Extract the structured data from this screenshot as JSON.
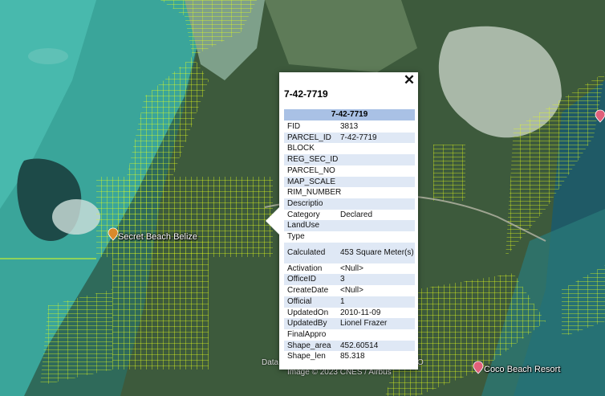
{
  "map": {
    "labels": [
      {
        "name": "Secret Beach Belize",
        "pin_color": "#d98a2b"
      },
      {
        "name": "Coco Beach Resort",
        "pin_color": "#e0607a"
      }
    ],
    "attribution_left": "Data",
    "attribution_main": "Image © 2023 CNES / Airbus",
    "attribution_right": "O"
  },
  "popup": {
    "title": "7-42-7719",
    "table_header": "7-42-7719",
    "close_symbol": "✕",
    "rows": [
      {
        "key": "FID",
        "value": "3813"
      },
      {
        "key": "PARCEL_ID",
        "value": "7-42-7719"
      },
      {
        "key": "BLOCK",
        "value": ""
      },
      {
        "key": "REG_SEC_ID",
        "value": ""
      },
      {
        "key": "PARCEL_NO",
        "value": ""
      },
      {
        "key": "MAP_SCALE",
        "value": ""
      },
      {
        "key": "RIM_NUMBER",
        "value": ""
      },
      {
        "key": "Descriptio",
        "value": ""
      },
      {
        "key": "Category",
        "value": "Declared"
      },
      {
        "key": "LandUse",
        "value": ""
      },
      {
        "key": "Type",
        "value": ""
      },
      {
        "key": "Calculated",
        "value": "453 Square Meter(s)"
      },
      {
        "key": "Activation",
        "value": "<Null>"
      },
      {
        "key": "OfficeID",
        "value": "3"
      },
      {
        "key": "CreateDate",
        "value": "<Null>"
      },
      {
        "key": "Official",
        "value": "1"
      },
      {
        "key": "UpdatedOn",
        "value": "2010-11-09"
      },
      {
        "key": "UpdatedBy",
        "value": "Lionel Frazer"
      },
      {
        "key": "FinalAppro",
        "value": ""
      },
      {
        "key": "Shape_area",
        "value": "452.60514"
      },
      {
        "key": "Shape_len",
        "value": "85.318"
      }
    ]
  },
  "colors": {
    "parcel_lines": "#e6ff1a",
    "header_bg": "#a9c1e5",
    "stripe": "#dfe8f5"
  }
}
